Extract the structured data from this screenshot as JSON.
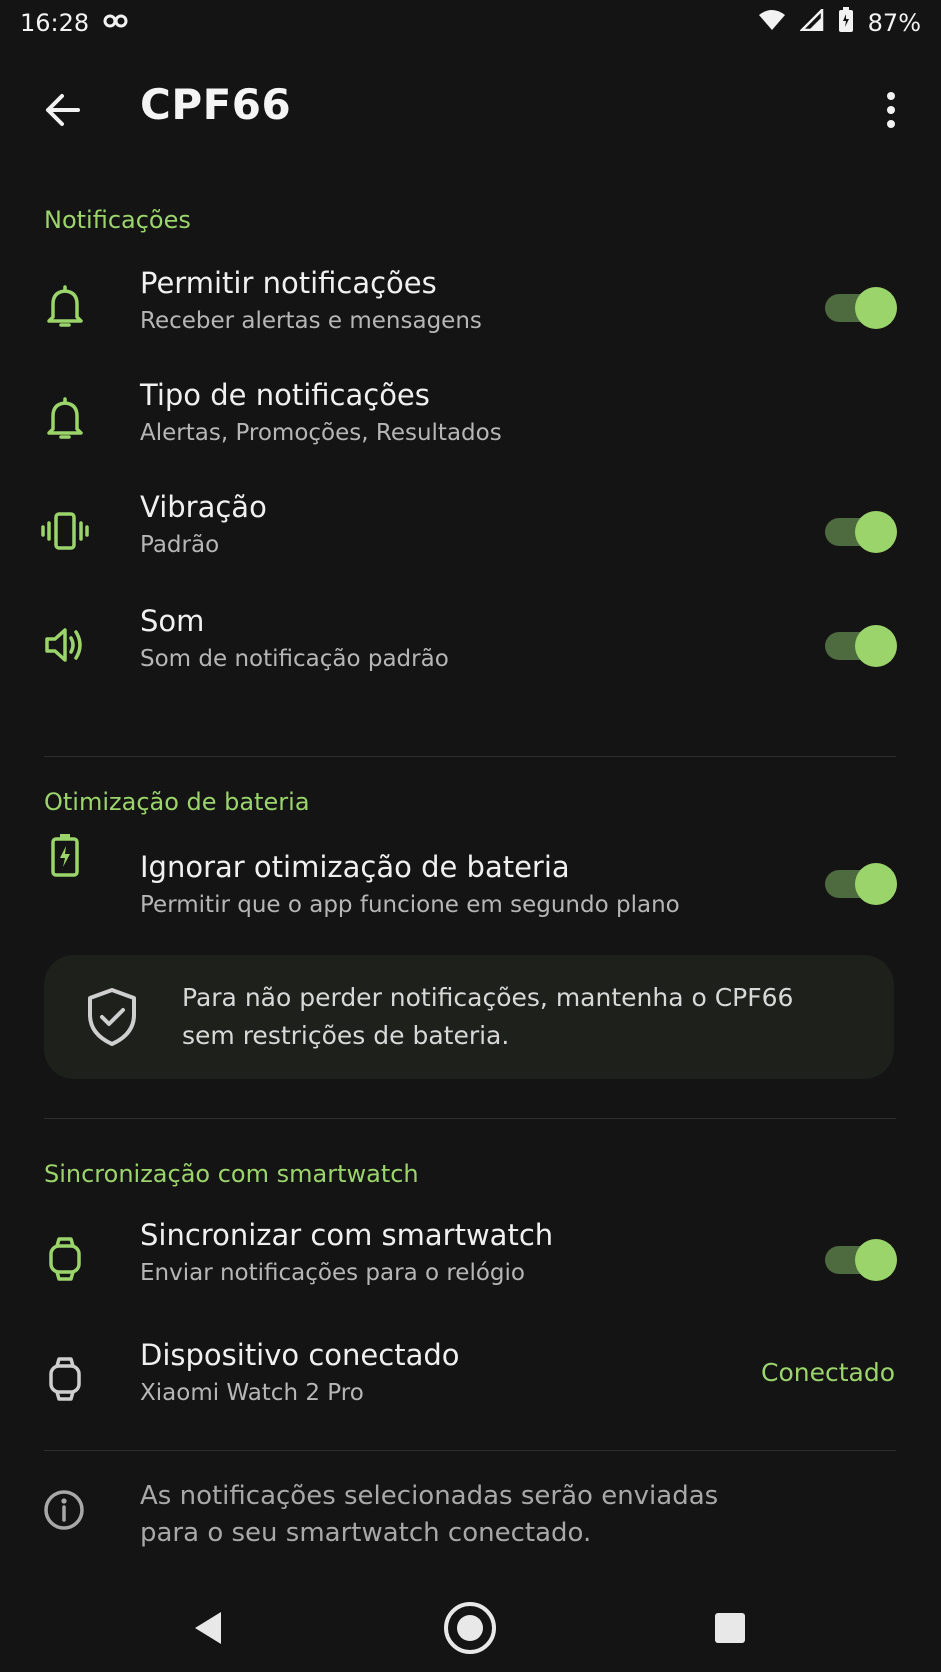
{
  "status_bar": {
    "time": "16:28",
    "battery": "87%",
    "icons": [
      "link-icon",
      "wifi-icon",
      "signal-icon",
      "battery-icon"
    ]
  },
  "top_bar": {
    "title": "CPF66",
    "back_icon": "arrow-left-icon",
    "more_icon": "more-vert-icon"
  },
  "sections": {
    "notifications": {
      "title": "Notificações",
      "items": [
        {
          "title": "Permitir notificações",
          "subtitle": "Receber alertas e mensagens",
          "icon": "bell-icon",
          "toggle": true
        },
        {
          "title": "Tipo de notificações",
          "subtitle": "Alertas, Promoções, Resultados",
          "icon": "bell-icon",
          "toggle": null
        },
        {
          "title": "Vibração",
          "subtitle": "Padrão",
          "icon": "vibration-icon",
          "toggle": true
        },
        {
          "title": "Som",
          "subtitle": "Som de notificação padrão",
          "icon": "volume-icon",
          "toggle": true
        }
      ]
    },
    "battery": {
      "title": "Otimização de bateria",
      "items": [
        {
          "title": "Ignorar otimização de bateria",
          "subtitle": "Permitir que o app funcione em segundo plano",
          "icon": "battery-charge-icon",
          "toggle": true
        }
      ],
      "info_card": {
        "line1": "Para não perder notificações, mantenha o CPF66",
        "line2": "sem restrições de bateria.",
        "icon": "shield-check-icon"
      }
    },
    "smartwatch": {
      "title": "Sincronização com smartwatch",
      "items": [
        {
          "title": "Sincronizar com smartwatch",
          "subtitle": "Enviar notificações para o relógio",
          "icon": "watch-icon",
          "toggle": true
        },
        {
          "title": "Dispositivo conectado",
          "subtitle": "Xiaomi Watch 2 Pro",
          "icon": "watch-icon",
          "status": "Conectado"
        }
      ],
      "footer_note": {
        "line1": "As notificações selecionadas serão enviadas",
        "line2": "para o seu smartwatch conectado.",
        "icon": "info-icon"
      }
    }
  },
  "nav_bar": {
    "icons": [
      "back-triangle-icon",
      "home-circle-icon",
      "recents-square-icon"
    ]
  },
  "colors": {
    "accent": "#9bd46b",
    "background": "#141414",
    "toggle_track": "#4d6b3e"
  }
}
